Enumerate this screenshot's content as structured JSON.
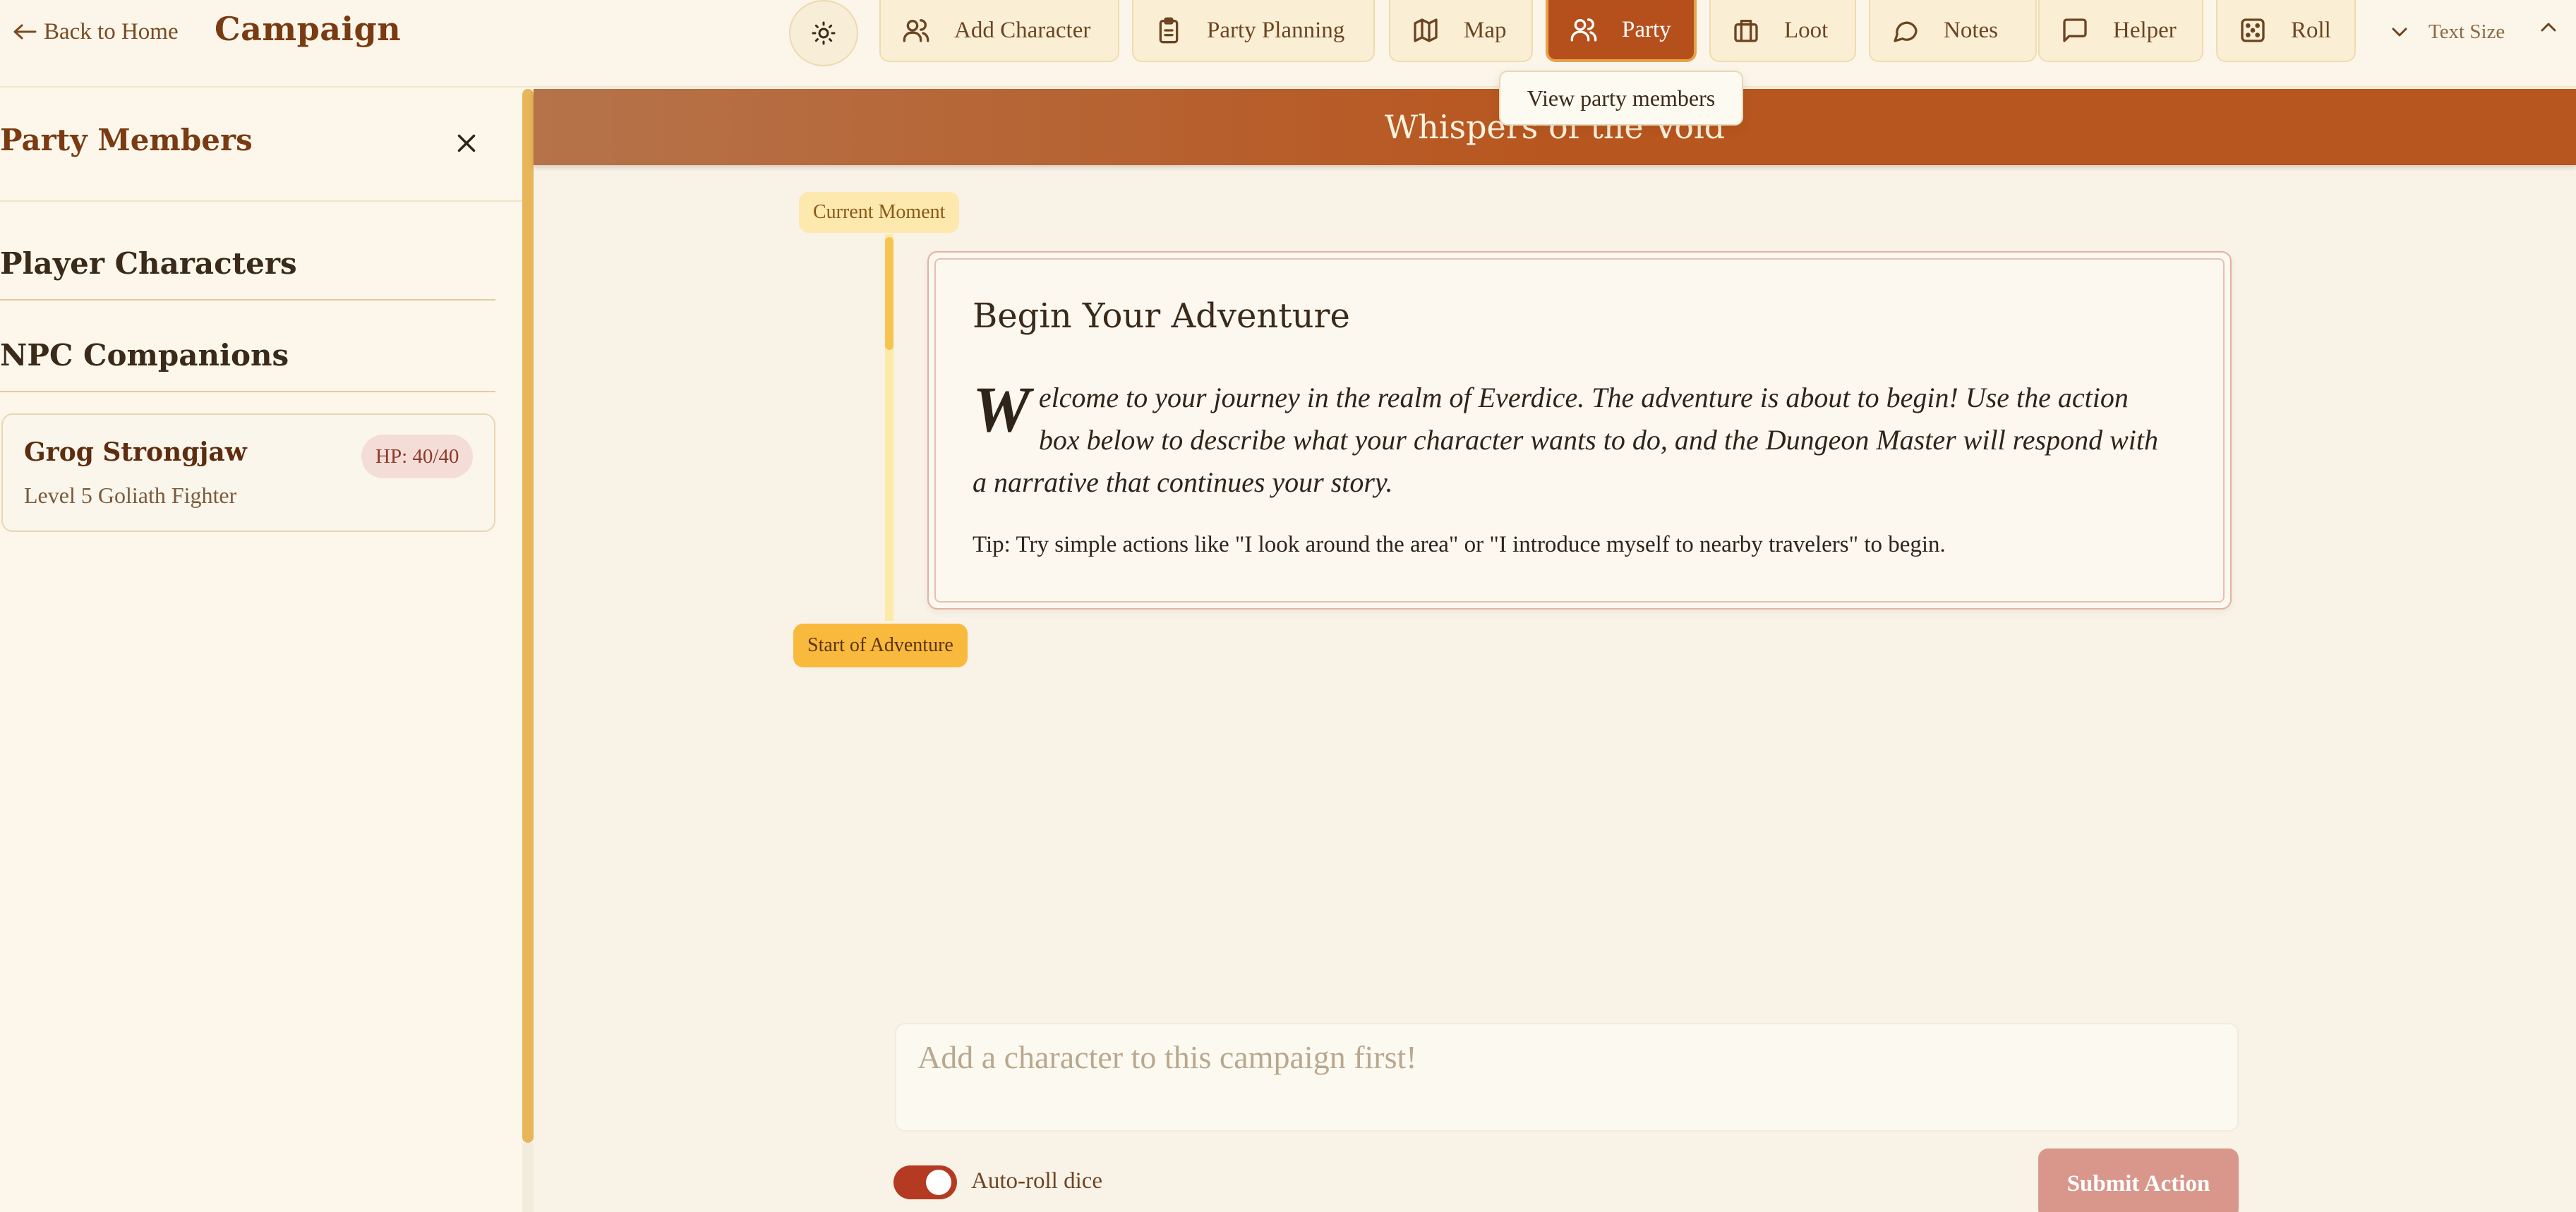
{
  "header": {
    "back_label": "Back to Home",
    "title": "Campaign",
    "nav": {
      "add_character": "Add Character",
      "party_planning": "Party Planning",
      "map": "Map",
      "party": "Party",
      "loot": "Loot",
      "notes": "Notes",
      "helper": "Helper",
      "roll": "Roll"
    },
    "active_nav": "party",
    "text_size_label": "Text Size",
    "tooltip": "View party members"
  },
  "icons": {
    "theme": "sun-icon",
    "add_character": "users-icon",
    "party_planning": "clipboard-icon",
    "map": "map-icon",
    "party": "users-icon",
    "loot": "briefcase-icon",
    "notes": "chat-bubble-icon",
    "helper": "message-square-icon",
    "roll": "dice-icon"
  },
  "sidebar": {
    "title": "Party Members",
    "sections": {
      "player_characters": "Player Characters",
      "npc_companions": "NPC Companions"
    },
    "members": [
      {
        "name": "Grog Strongjaw",
        "subtitle": "Level 5 Goliath Fighter",
        "hp": "HP: 40/40"
      }
    ]
  },
  "main": {
    "campaign_name": "Whispers of the Void",
    "timeline": {
      "current_label": "Current Moment",
      "start_label": "Start of Adventure"
    },
    "story": {
      "title": "Begin Your Adventure",
      "dropcap": "W",
      "body": "elcome to your journey in the realm of Everdice. The adventure is about to begin! Use the action box below to describe what your character wants to do, and the Dungeon Master will respond with a narrative that continues your story.",
      "tip": "Tip: Try simple actions like \"I look around the area\" or \"I introduce myself to nearby travelers\" to begin."
    }
  },
  "composer": {
    "placeholder": "Add a character to this campaign first!",
    "auto_roll_label": "Auto-roll dice",
    "auto_roll_on": true,
    "submit_label": "Submit Action"
  },
  "colors": {
    "accent": "#b5501c",
    "banner": "#b8561f",
    "background": "#fbf6e9",
    "timeline": "#f7c54f",
    "submit_disabled": "#d8978a",
    "toggle": "#b53a22"
  }
}
